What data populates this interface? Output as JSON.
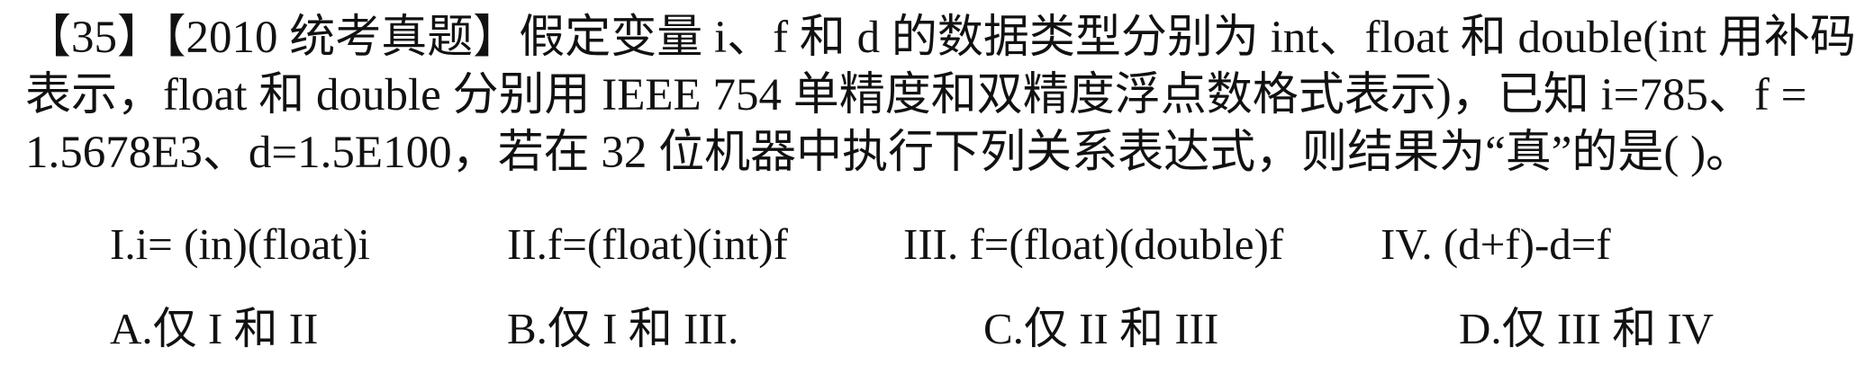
{
  "question": {
    "lines": [
      "【35】【2010 统考真题】假定变量 i、f 和 d 的数据类型分别为 int、float 和 double(int 用补码",
      "表示，float 和 double 分别用 IEEE   754  单精度和双精度浮点数格式表示)，已知  i=785、f =",
      "1.5678E3、d=1.5E100，若在 32 位机器中执行下列关系表达式，则结果为“真”的是(      )。"
    ]
  },
  "statements": [
    "I.i= (in)(float)i",
    "II.f=(float)(int)f",
    "III. f=(float)(double)f",
    "IV. (d+f)-d=f"
  ],
  "options": [
    "A.仅 I 和 II",
    "B.仅 I 和 III.",
    "C.仅 II 和 III",
    "D.仅 III 和 IV"
  ]
}
